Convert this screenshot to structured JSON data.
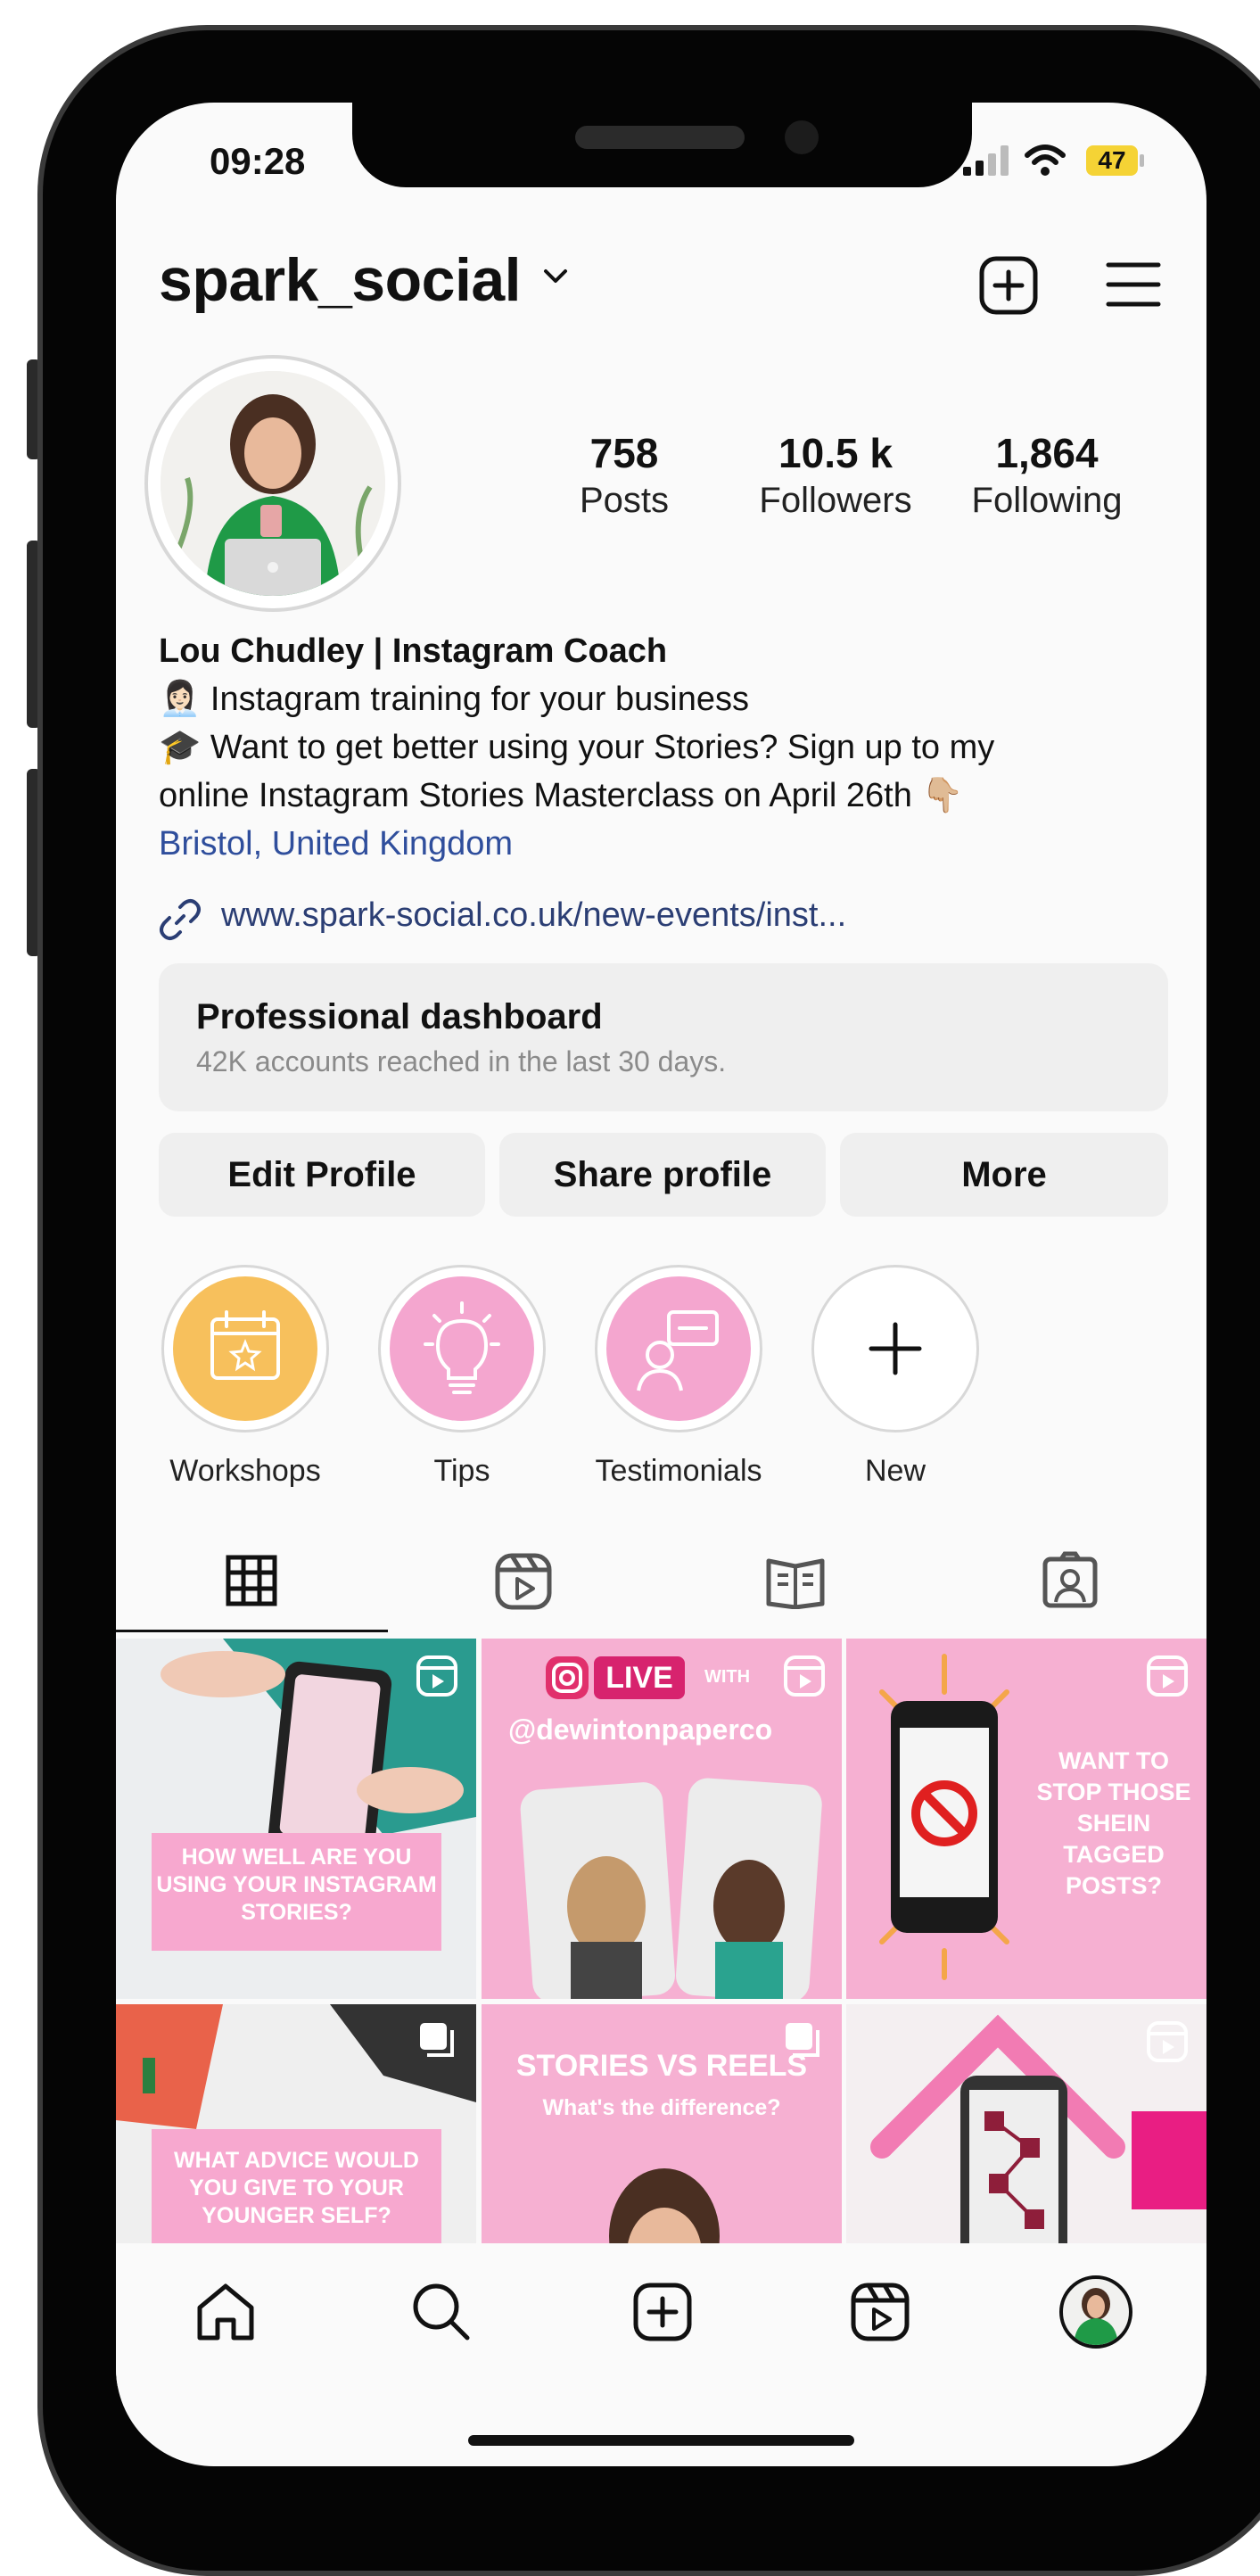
{
  "status_bar": {
    "time": "09:28",
    "battery": "47"
  },
  "profile": {
    "username": "spark_social",
    "stats": [
      {
        "value": "758",
        "label": "Posts"
      },
      {
        "value": "10.5 k",
        "label": "Followers"
      },
      {
        "value": "1,864",
        "label": "Following"
      }
    ],
    "bio": {
      "name": "Lou Chudley | Instagram Coach",
      "line1_emoji": "👩🏻‍💼",
      "line1": "Instagram training for your business",
      "line2_emoji": "🎓",
      "line2a": "Want to get better using your Stories? Sign up to my",
      "line2b": "online Instagram Stories Masterclass on April 26th",
      "line2_end_emoji": "👇🏼",
      "location": "Bristol, United Kingdom",
      "link": "www.spark-social.co.uk/new-events/inst..."
    }
  },
  "dashboard": {
    "title": "Professional dashboard",
    "subtitle": "42K accounts reached in the last 30 days."
  },
  "buttons": {
    "edit": "Edit Profile",
    "share": "Share profile",
    "more": "More"
  },
  "highlights": [
    {
      "label": "Workshops",
      "color": "#f7c05c",
      "icon": "calendar-icon"
    },
    {
      "label": "Tips",
      "color": "#f4a6cf",
      "icon": "lightbulb-icon"
    },
    {
      "label": "Testimonials",
      "color": "#f4a6cf",
      "icon": "review-icon"
    },
    {
      "label": "New",
      "color": "#ffffff",
      "icon": "plus-icon"
    }
  ],
  "posts": {
    "p1": "HOW WELL ARE YOU USING YOUR INSTAGRAM STORIES?",
    "p2_live": "LIVE",
    "p2_with": "WITH",
    "p2_handle": "@dewintonpaperco",
    "p3": "WANT TO STOP THOSE SHEIN TAGGED POSTS?",
    "p4": "WHAT ADVICE WOULD YOU GIVE TO YOUR YOUNGER SELF?",
    "p5_title": "STORIES VS REELS",
    "p5_sub": "What's the difference?"
  },
  "colors": {
    "accent_pink": "#f6b0d2",
    "link_blue": "#2f4e9c",
    "highlight_orange": "#f7c05c"
  }
}
